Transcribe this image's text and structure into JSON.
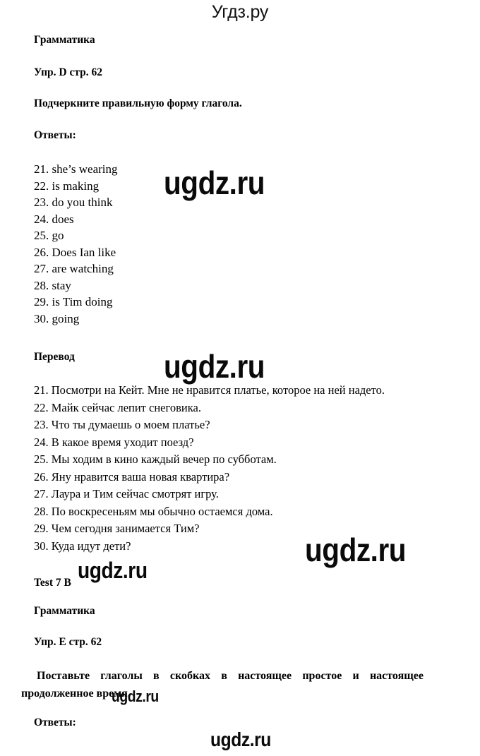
{
  "site": {
    "logo_text": "Угдз.ру",
    "watermark_text": "ugdz.ru"
  },
  "sections": {
    "grammar_heading_1": "Грамматика",
    "exercise_heading_1": "Упр. D стр. 62",
    "task_1": "Подчеркните правильную форму глагола.",
    "answers_heading_1": "Ответы:",
    "translation_heading": "Перевод",
    "test_heading": "Test 7 B",
    "grammar_heading_2": "Грамматика",
    "exercise_heading_2": "Упр. E стр. 62",
    "task_2": "Поставьте глаголы в скобках в настоящее простое и настоящее продолженное время.",
    "answers_heading_2": "Ответы:"
  },
  "answers": [
    "21. she’s wearing",
    "22. is making",
    "23. do you think",
    "24. does",
    "25. go",
    "26. Does Ian like",
    "27. are watching",
    "28. stay",
    "29. is Tim doing",
    "30. going"
  ],
  "translations": [
    "21. Посмотри на  Кейт. Мне не нравится платье, которое на ней надето.",
    "22. Майк сейчас лепит снеговика.",
    "23. Что ты думаешь о  моем платье?",
    "24. В какое время уходит поезд?",
    "25. Мы ходим в кино каждый вечер по субботам.",
    "26. Яну нравится ваша новая квартира?",
    "27. Лаура и Тим сейчас смотрят игру.",
    "28. По воскресеньям мы обычно остаемся дома.",
    "29. Чем сегодня занимается Тим?",
    "30. Куда идут дети?"
  ],
  "colors": {
    "text": "#000000",
    "background": "#ffffff",
    "watermark": "#0a0a0a"
  }
}
